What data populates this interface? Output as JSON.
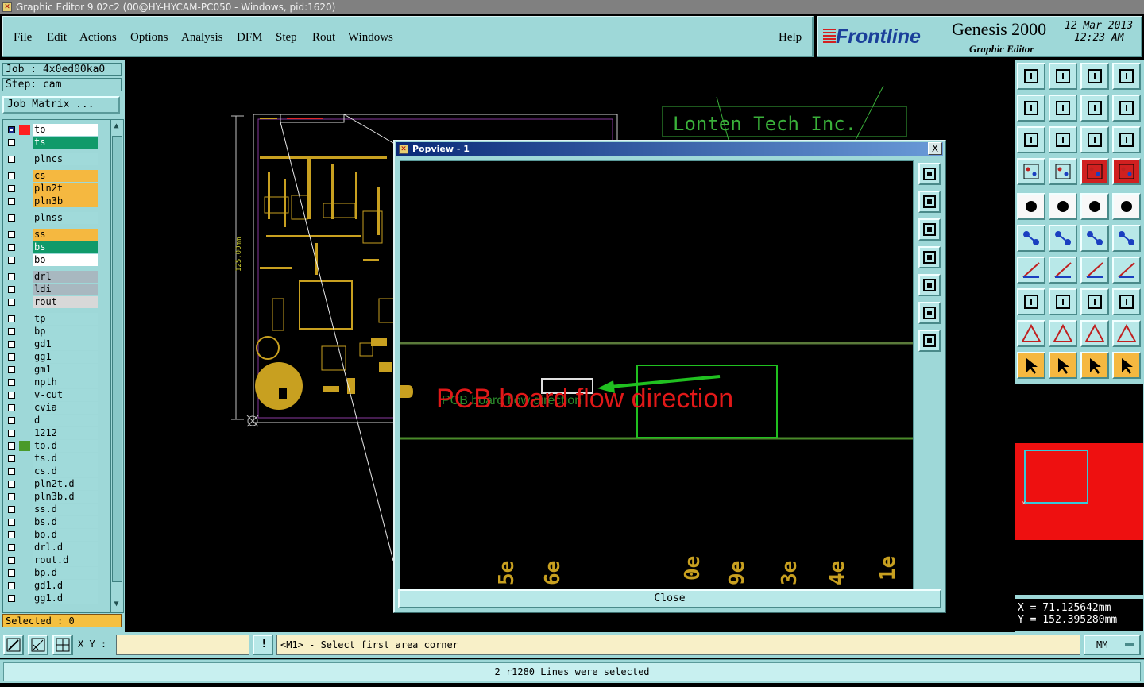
{
  "window": {
    "title": "Graphic Editor 9.02c2 (00@HY-HYCAM-PC050 - Windows, pid:1620)"
  },
  "menu": {
    "items": [
      "File",
      "Edit",
      "Actions",
      "Options",
      "Analysis",
      "DFM",
      "Step",
      "Rout",
      "Windows"
    ],
    "help": "Help"
  },
  "brand": {
    "logo": "Frontline",
    "product": "Genesis 2000",
    "subtitle": "Graphic Editor",
    "date": "12 Mar 2013",
    "time": "12:23 AM",
    "logo_color": "#1a3f9a",
    "accent_color": "#d32020"
  },
  "job": {
    "job_label": "Job : 4x0ed00ka0",
    "step_label": "Step: cam",
    "matrix_button": "Job Matrix ..."
  },
  "layers": [
    {
      "name": "to",
      "color": "#ff2020",
      "bg": "#ffffff",
      "checked": true,
      "pen": true
    },
    {
      "name": "ts",
      "color": "",
      "bg": "#109a6a",
      "checked": false,
      "pen": false
    },
    {
      "name": "plncs",
      "color": "",
      "bg": "#a0dada",
      "checked": false,
      "pen": false,
      "gap": true
    },
    {
      "name": "cs",
      "color": "",
      "bg": "#f5b840",
      "checked": false,
      "pen": true,
      "gap": true
    },
    {
      "name": "pln2t",
      "color": "",
      "bg": "#f5b840",
      "checked": false,
      "pen": false
    },
    {
      "name": "pln3b",
      "color": "",
      "bg": "#f5b840",
      "checked": false,
      "pen": false
    },
    {
      "name": "plnss",
      "color": "",
      "bg": "#a0dada",
      "checked": false,
      "pen": false,
      "gap": true
    },
    {
      "name": "ss",
      "color": "",
      "bg": "#f5b840",
      "checked": false,
      "pen": true,
      "gap": true
    },
    {
      "name": "bs",
      "color": "",
      "bg": "#109a6a",
      "checked": false,
      "pen": false
    },
    {
      "name": "bo",
      "color": "",
      "bg": "#ffffff",
      "checked": false,
      "pen": true
    },
    {
      "name": "drl",
      "color": "",
      "bg": "#a8b8c0",
      "checked": false,
      "pen": false,
      "gap": true
    },
    {
      "name": "ldi",
      "color": "",
      "bg": "#a8b8c0",
      "checked": false,
      "pen": false
    },
    {
      "name": "rout",
      "color": "",
      "bg": "#d8d8d8",
      "checked": false,
      "pen": false
    },
    {
      "name": "tp",
      "color": "",
      "bg": "#a0dada",
      "checked": false,
      "pen": false,
      "gap": true
    },
    {
      "name": "bp",
      "color": "",
      "bg": "#a0dada",
      "checked": false,
      "pen": false
    },
    {
      "name": "gd1",
      "color": "",
      "bg": "#a0dada",
      "checked": false,
      "pen": true
    },
    {
      "name": "gg1",
      "color": "",
      "bg": "#a0dada",
      "checked": false,
      "pen": false
    },
    {
      "name": "gm1",
      "color": "",
      "bg": "#a0dada",
      "checked": false,
      "pen": false
    },
    {
      "name": "npth",
      "color": "",
      "bg": "#a0dada",
      "checked": false,
      "pen": false
    },
    {
      "name": "v-cut",
      "color": "",
      "bg": "#a0dada",
      "checked": false,
      "pen": false
    },
    {
      "name": "cvia",
      "color": "",
      "bg": "#a0dada",
      "checked": false,
      "pen": false
    },
    {
      "name": "d",
      "color": "",
      "bg": "#a0dada",
      "checked": false,
      "pen": false
    },
    {
      "name": "1212",
      "color": "",
      "bg": "#a0dada",
      "checked": false,
      "pen": false
    },
    {
      "name": "to.d",
      "color": "#4a9a2a",
      "bg": "#a0dada",
      "checked": false,
      "pen": true
    },
    {
      "name": "ts.d",
      "color": "",
      "bg": "#a0dada",
      "checked": false,
      "pen": false
    },
    {
      "name": "cs.d",
      "color": "",
      "bg": "#a0dada",
      "checked": false,
      "pen": true
    },
    {
      "name": "pln2t.d",
      "color": "",
      "bg": "#a0dada",
      "checked": false,
      "pen": false
    },
    {
      "name": "pln3b.d",
      "color": "",
      "bg": "#a0dada",
      "checked": false,
      "pen": false
    },
    {
      "name": "ss.d",
      "color": "",
      "bg": "#a0dada",
      "checked": false,
      "pen": true
    },
    {
      "name": "bs.d",
      "color": "",
      "bg": "#a0dada",
      "checked": false,
      "pen": false
    },
    {
      "name": "bo.d",
      "color": "",
      "bg": "#a0dada",
      "checked": false,
      "pen": true
    },
    {
      "name": "drl.d",
      "color": "",
      "bg": "#a0dada",
      "checked": false,
      "pen": false
    },
    {
      "name": "rout.d",
      "color": "",
      "bg": "#a0dada",
      "checked": false,
      "pen": false
    },
    {
      "name": "bp.d",
      "color": "",
      "bg": "#a0dada",
      "checked": false,
      "pen": false
    },
    {
      "name": "gd1.d",
      "color": "",
      "bg": "#a0dada",
      "checked": false,
      "pen": true
    },
    {
      "name": "gg1.d",
      "color": "",
      "bg": "#a0dada",
      "checked": false,
      "pen": false
    }
  ],
  "selected_label": "Selected : 0",
  "canvas": {
    "company_text": "Lonten Tech Inc.",
    "dimension_label": "125.00mm"
  },
  "popview": {
    "title": "Popview - 1",
    "close_x": "X",
    "annotation": "PCB board flow direction",
    "annotation_color": "#e01818",
    "pad_labels": [
      "5e",
      "6e",
      "0e",
      "9e",
      "3e",
      "4e",
      "1e"
    ],
    "close_button": "Close"
  },
  "coords": {
    "x_label": "X = 71.125642mm",
    "y_label": "Y = 152.395280mm"
  },
  "bottom": {
    "xy_label": "X Y :",
    "xy_value": "",
    "info_icon": "!",
    "message": "<M1> - Select first area corner",
    "units": "MM",
    "status": "2 r1280 Lines were selected"
  }
}
